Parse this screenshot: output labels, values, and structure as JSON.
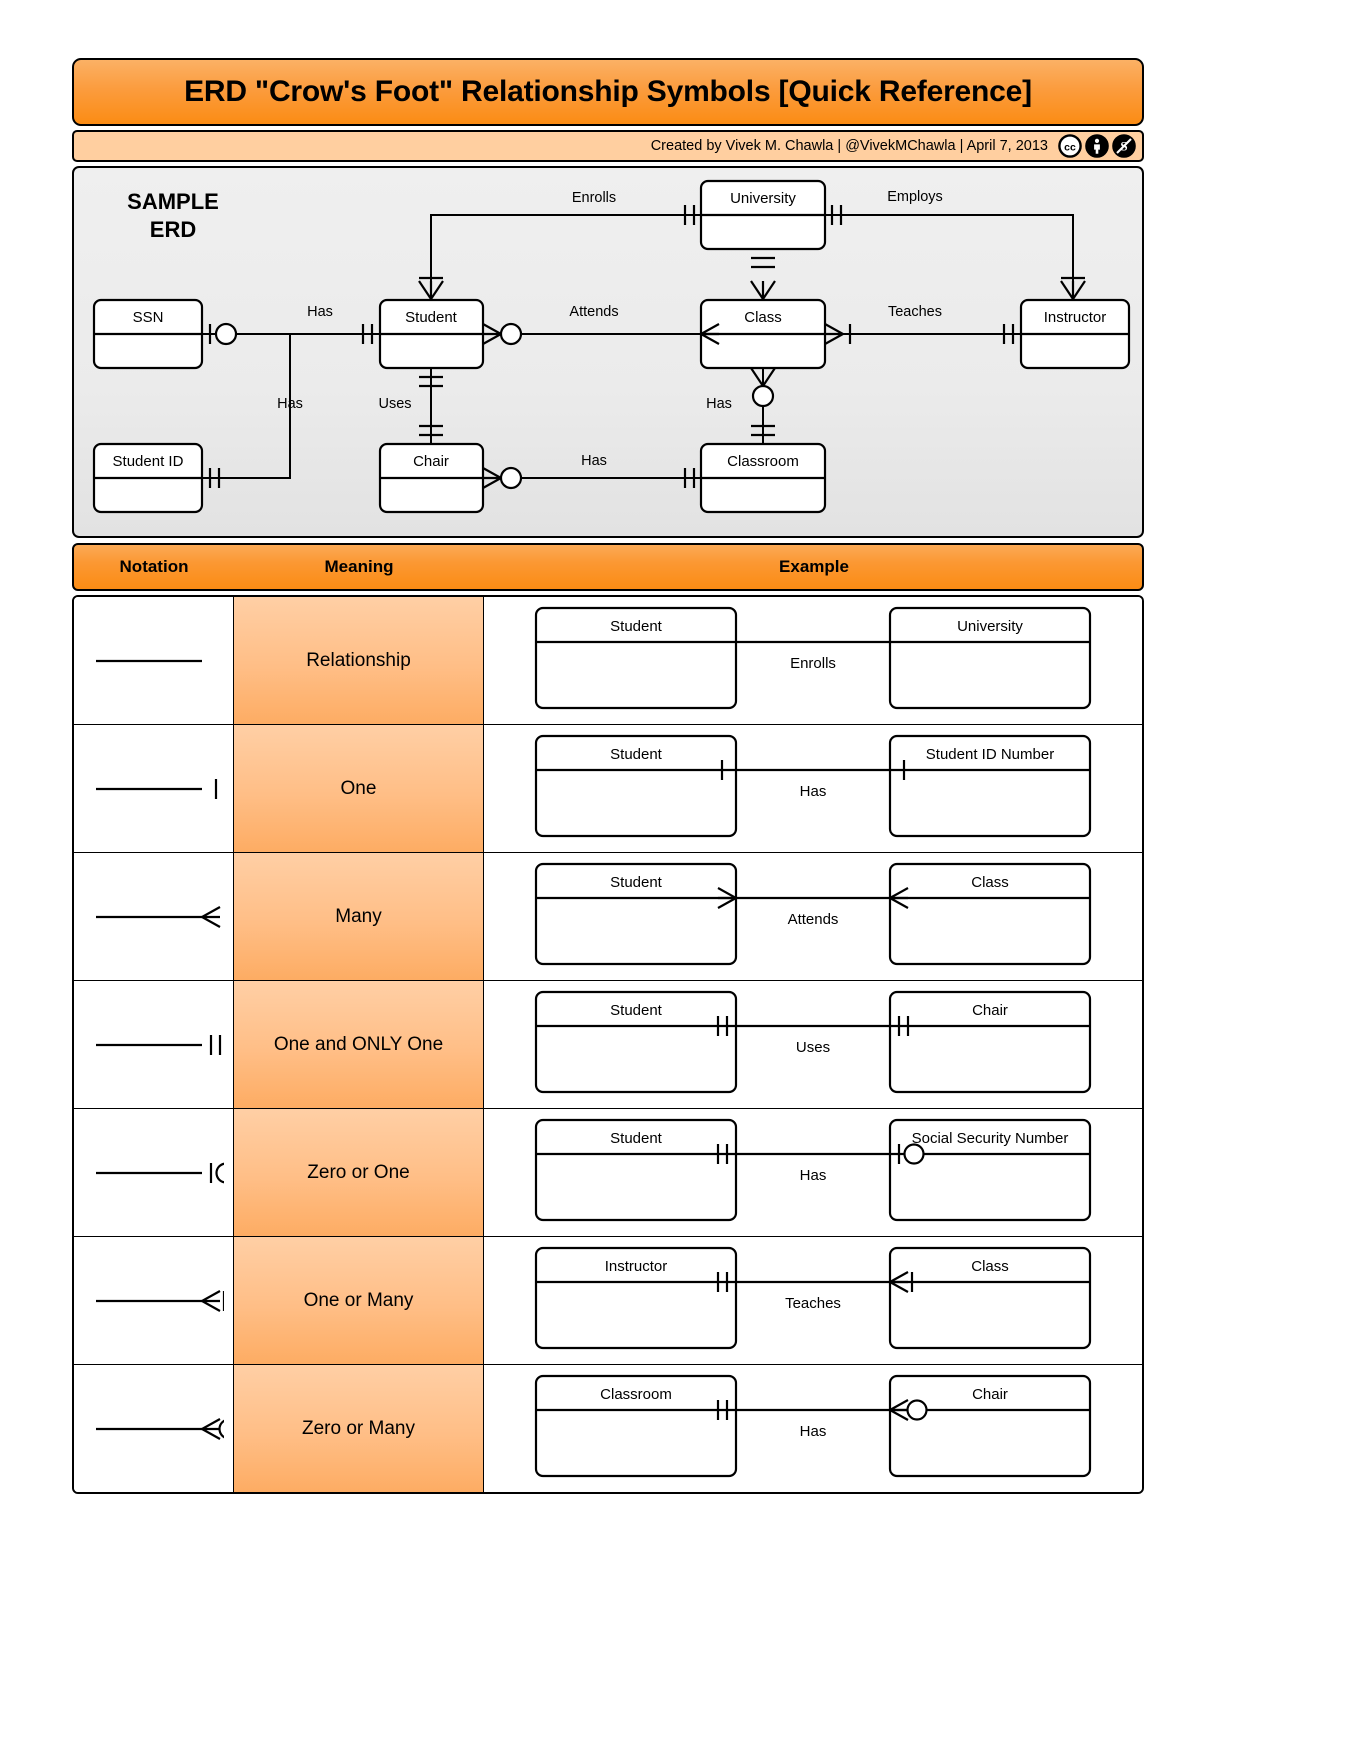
{
  "header": {
    "title": "ERD \"Crow's Foot\" Relationship Symbols [Quick Reference]",
    "credit": "Created by Vivek M. Chawla |  @VivekMChawla  |  April 7, 2013",
    "cc_badges": [
      {
        "name": "cc-badge-icon",
        "label": "cc"
      },
      {
        "name": "cc-by-badge-icon",
        "label": "BY"
      },
      {
        "name": "cc-nc-badge-icon",
        "label": "NC"
      }
    ]
  },
  "sample_erd": {
    "label": "SAMPLE\nERD",
    "entities": [
      {
        "id": "ssn",
        "name": "SSN"
      },
      {
        "id": "student_id",
        "name": "Student ID"
      },
      {
        "id": "student",
        "name": "Student"
      },
      {
        "id": "chair",
        "name": "Chair"
      },
      {
        "id": "university",
        "name": "University"
      },
      {
        "id": "class",
        "name": "Class"
      },
      {
        "id": "classroom",
        "name": "Classroom"
      },
      {
        "id": "instructor",
        "name": "Instructor"
      }
    ],
    "relationships": [
      {
        "label": "Has",
        "from": "ssn",
        "to": "student"
      },
      {
        "label": "Has",
        "from": "student_id",
        "to": "student"
      },
      {
        "label": "Uses",
        "from": "student",
        "to": "chair"
      },
      {
        "label": "Enrolls",
        "from": "student",
        "to": "university"
      },
      {
        "label": "Attends",
        "from": "student",
        "to": "class"
      },
      {
        "label": "Employs",
        "from": "university",
        "to": "instructor"
      },
      {
        "label": "Teaches",
        "from": "class",
        "to": "instructor"
      },
      {
        "label": "Has",
        "from": "class",
        "to": "classroom"
      },
      {
        "label": "Has",
        "from": "chair",
        "to": "classroom"
      }
    ]
  },
  "table": {
    "columns": [
      "Notation",
      "Meaning",
      "Example"
    ],
    "rows": [
      {
        "notation": "plain-line",
        "meaning": "Relationship",
        "example": {
          "left": "Student",
          "right": "University",
          "label": "Enrolls",
          "left_symbol": "none",
          "right_symbol": "none"
        }
      },
      {
        "notation": "one",
        "meaning": "One",
        "example": {
          "left": "Student",
          "right": "Student ID Number",
          "label": "Has",
          "left_symbol": "one",
          "right_symbol": "one"
        }
      },
      {
        "notation": "many",
        "meaning": "Many",
        "example": {
          "left": "Student",
          "right": "Class",
          "label": "Attends",
          "left_symbol": "many",
          "right_symbol": "many"
        }
      },
      {
        "notation": "one-only-one",
        "meaning": "One and ONLY One",
        "example": {
          "left": "Student",
          "right": "Chair",
          "label": "Uses",
          "left_symbol": "one-only-one",
          "right_symbol": "one-only-one"
        }
      },
      {
        "notation": "zero-or-one",
        "meaning": "Zero or One",
        "example": {
          "left": "Student",
          "right": "Social Security Number",
          "label": "Has",
          "left_symbol": "one-only-one",
          "right_symbol": "zero-or-one"
        }
      },
      {
        "notation": "one-or-many",
        "meaning": "One or Many",
        "example": {
          "left": "Instructor",
          "right": "Class",
          "label": "Teaches",
          "left_symbol": "one-only-one",
          "right_symbol": "one-or-many"
        }
      },
      {
        "notation": "zero-or-many",
        "meaning": "Zero or Many",
        "example": {
          "left": "Classroom",
          "right": "Chair",
          "label": "Has",
          "left_symbol": "one-only-one",
          "right_symbol": "zero-or-many"
        }
      }
    ]
  },
  "colors": {
    "title_orange": "#fb8c14",
    "credit_peach": "#ffcfa0",
    "meaning_orange": "#ffbe86",
    "panel_gray": "#ebebeb",
    "line_black": "#000000"
  }
}
